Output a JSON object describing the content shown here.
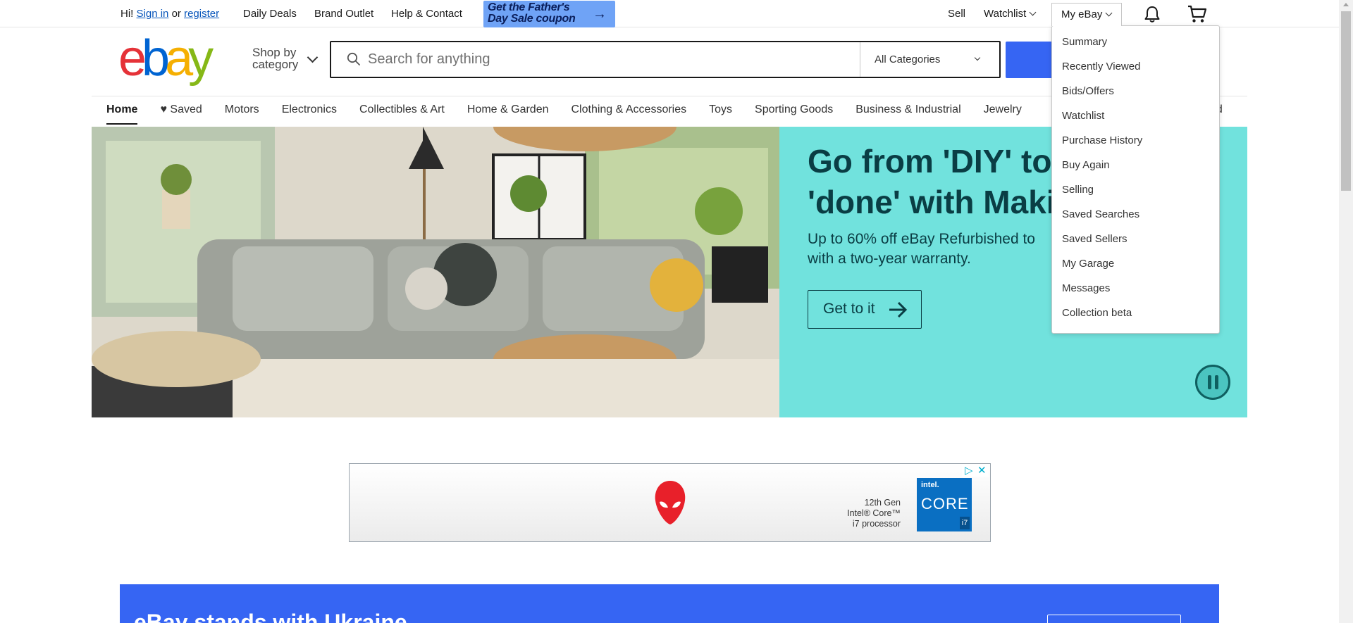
{
  "topbar": {
    "greeting": "Hi!",
    "sign_in": "Sign in",
    "or": "or",
    "register": "register",
    "daily_deals": "Daily Deals",
    "brand_outlet": "Brand Outlet",
    "help_contact": "Help & Contact",
    "promo_line1": "Get the Father's",
    "promo_line2": "Day Sale coupon",
    "sell": "Sell",
    "watchlist": "Watchlist",
    "my_ebay": "My eBay"
  },
  "header": {
    "logo": [
      "e",
      "b",
      "a",
      "y"
    ],
    "shop_by_line1": "Shop by",
    "shop_by_line2": "category",
    "search_placeholder": "Search for anything",
    "category_select": "All Categories"
  },
  "category_nav": [
    "Home",
    "Saved",
    "Motors",
    "Electronics",
    "Collectibles & Art",
    "Home & Garden",
    "Clothing & Accessories",
    "Toys",
    "Sporting Goods",
    "Business & Industrial",
    "Jewelry"
  ],
  "category_nav_tail": "ed",
  "hero": {
    "title_line1": "Go from 'DIY' to",
    "title_line2": "'done' with Maki",
    "sub_line1": "Up to 60% off eBay Refurbished to",
    "sub_line2": "with a two-year warranty.",
    "button": "Get to it"
  },
  "ad": {
    "processor_line1": "12th Gen",
    "processor_line2": "Intel® Core™",
    "processor_line3": "i7 processor",
    "intel_brand": "intel.",
    "intel_core": "CORE",
    "intel_tier": "i7"
  },
  "ukraine": {
    "title": "eBay stands with Ukraine"
  },
  "my_ebay_menu": [
    "Summary",
    "Recently Viewed",
    "Bids/Offers",
    "Watchlist",
    "Purchase History",
    "Buy Again",
    "Selling",
    "Saved Searches",
    "Saved Sellers",
    "My Garage",
    "Messages",
    "Collection beta"
  ],
  "colors": {
    "brand_blue": "#3665f3",
    "hero_teal": "#71e2dd",
    "hero_text": "#0a3d44"
  }
}
